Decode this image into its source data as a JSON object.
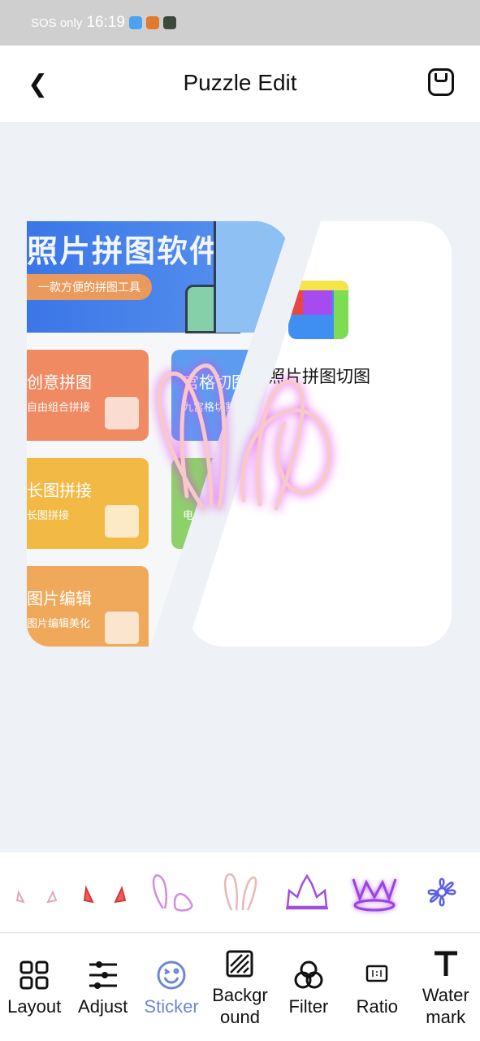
{
  "status_bar": {
    "carrier": "SOS only",
    "time": "16:19",
    "icons": [
      "weather-app-icon",
      "novel-app-icon",
      "game-app-icon",
      "nfc-icon",
      "vibrate-icon",
      "wifi-icon",
      "alert-icon",
      "battery-icon"
    ]
  },
  "header": {
    "title": "Puzzle Edit",
    "back_icon": "chevron-left-icon",
    "save_icon": "save-icon"
  },
  "canvas": {
    "left_image": {
      "banner_title": "照片拼图软件",
      "banner_tagline": "一款方便的拼图工具",
      "cards": [
        {
          "title": "创意拼图",
          "subtitle": "自由组合拼接",
          "color": "#ef8a62"
        },
        {
          "title": "宫格切图",
          "subtitle": "九宫格切割",
          "color": "#5c9cf0"
        },
        {
          "title": "长图拼接",
          "subtitle": "长图拼接",
          "color": "#f3b945"
        },
        {
          "title": "",
          "subtitle": "电",
          "color": "#8ed06a"
        },
        {
          "title": "图片编辑",
          "subtitle": "图片编辑美化",
          "color": "#f0a95a"
        }
      ]
    },
    "right_image": {
      "app_name": "照片拼图切图"
    },
    "placed_sticker": "neon-bunny-ears"
  },
  "stickers": [
    "devil-horns-pink",
    "devil-horns-red",
    "bunny-ears-purple",
    "bunny-ears-pink",
    "crown-purple",
    "crown-glow",
    "flower-blue"
  ],
  "toolbar": {
    "active": "Sticker",
    "accent": "#6a88d6",
    "items": [
      {
        "label": "Layout",
        "icon": "layout-grid-icon"
      },
      {
        "label": "Adjust",
        "icon": "sliders-icon"
      },
      {
        "label": "Sticker",
        "icon": "smiley-icon"
      },
      {
        "label": "Backgr ound",
        "icon": "background-hatch-icon"
      },
      {
        "label": "Filter",
        "icon": "filter-circles-icon"
      },
      {
        "label": "Ratio",
        "icon": "ratio-icon"
      },
      {
        "label": "Water mark",
        "icon": "text-t-icon"
      }
    ]
  }
}
